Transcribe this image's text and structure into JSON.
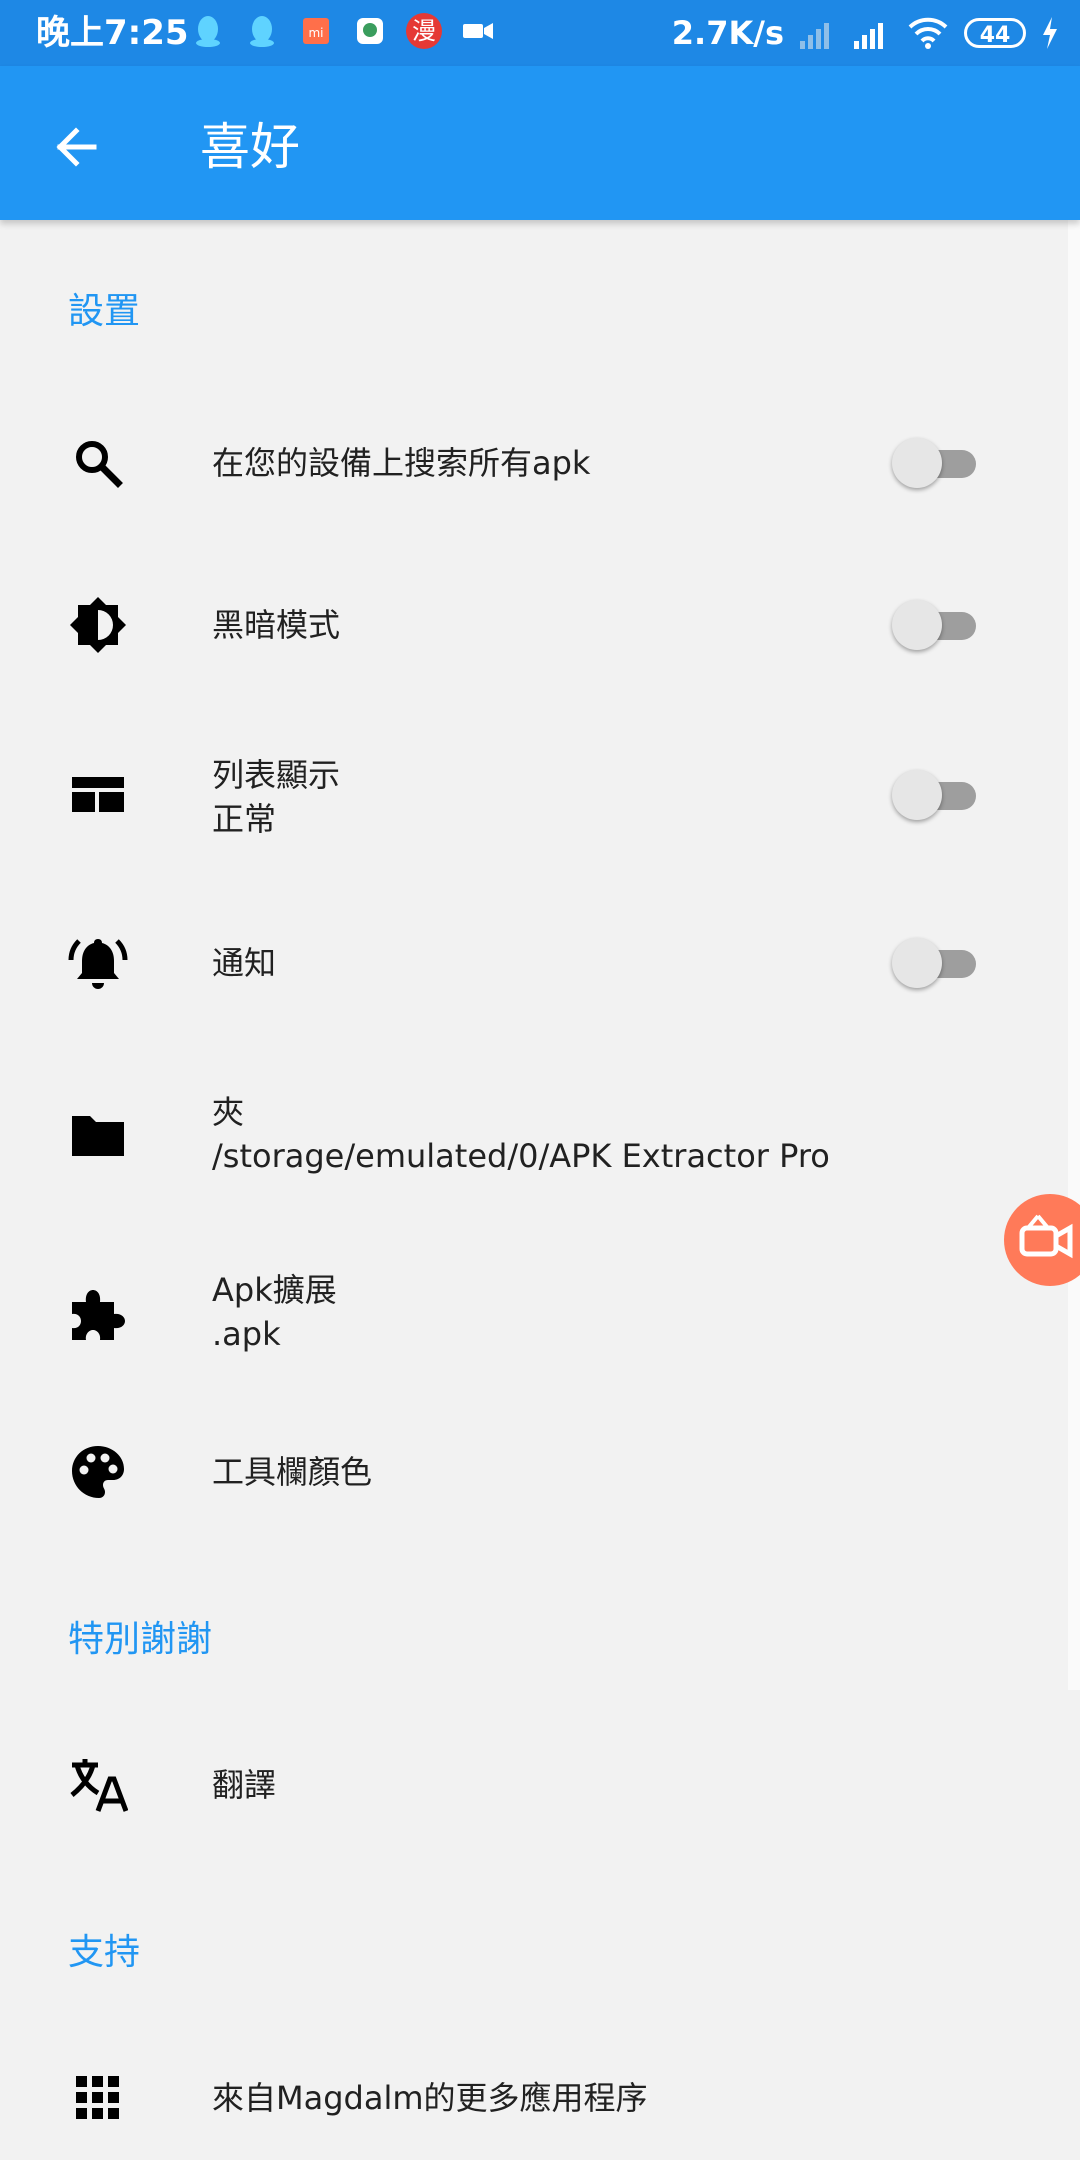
{
  "status_bar": {
    "time": "晚上7:25",
    "notif_manga": "漫",
    "speed": "2.7K/s",
    "battery": "44",
    "icons": [
      "qq-icon",
      "qq-icon",
      "mi-icon",
      "app-icon",
      "manga-icon",
      "video-icon",
      "signal-icon",
      "signal-icon",
      "wifi-icon",
      "battery-icon",
      "charging-icon"
    ]
  },
  "appbar": {
    "title": "喜好"
  },
  "sections": {
    "settings": "設置",
    "thanks": "特別謝謝",
    "support": "支持"
  },
  "rows": [
    {
      "title": "在您的設備上搜索所有apk",
      "icon": "search-icon",
      "toggle": false
    },
    {
      "title": "黑暗模式",
      "icon": "brightness-icon",
      "toggle": false
    },
    {
      "title": "列表顯示",
      "subtitle": "正常",
      "icon": "list-layout-icon",
      "toggle": false
    },
    {
      "title": "通知",
      "icon": "bell-icon",
      "toggle": false
    },
    {
      "title": "夾",
      "subtitle": "/storage/emulated/0/APK Extractor Pro",
      "icon": "folder-icon"
    },
    {
      "title": "Apk擴展",
      "subtitle": ".apk",
      "icon": "puzzle-icon"
    },
    {
      "title": "工具欄顏色",
      "icon": "palette-icon"
    },
    {
      "title": "翻譯",
      "icon": "translate-icon"
    },
    {
      "title": "來自Magdalm的更多應用程序",
      "icon": "apps-grid-icon"
    }
  ],
  "colors": {
    "status_bar": "#1e88e5",
    "app_bar": "#2196f3",
    "accent": "#2196f3",
    "background": "#f2f2f2",
    "recorder_fab": "#ff7a59"
  }
}
